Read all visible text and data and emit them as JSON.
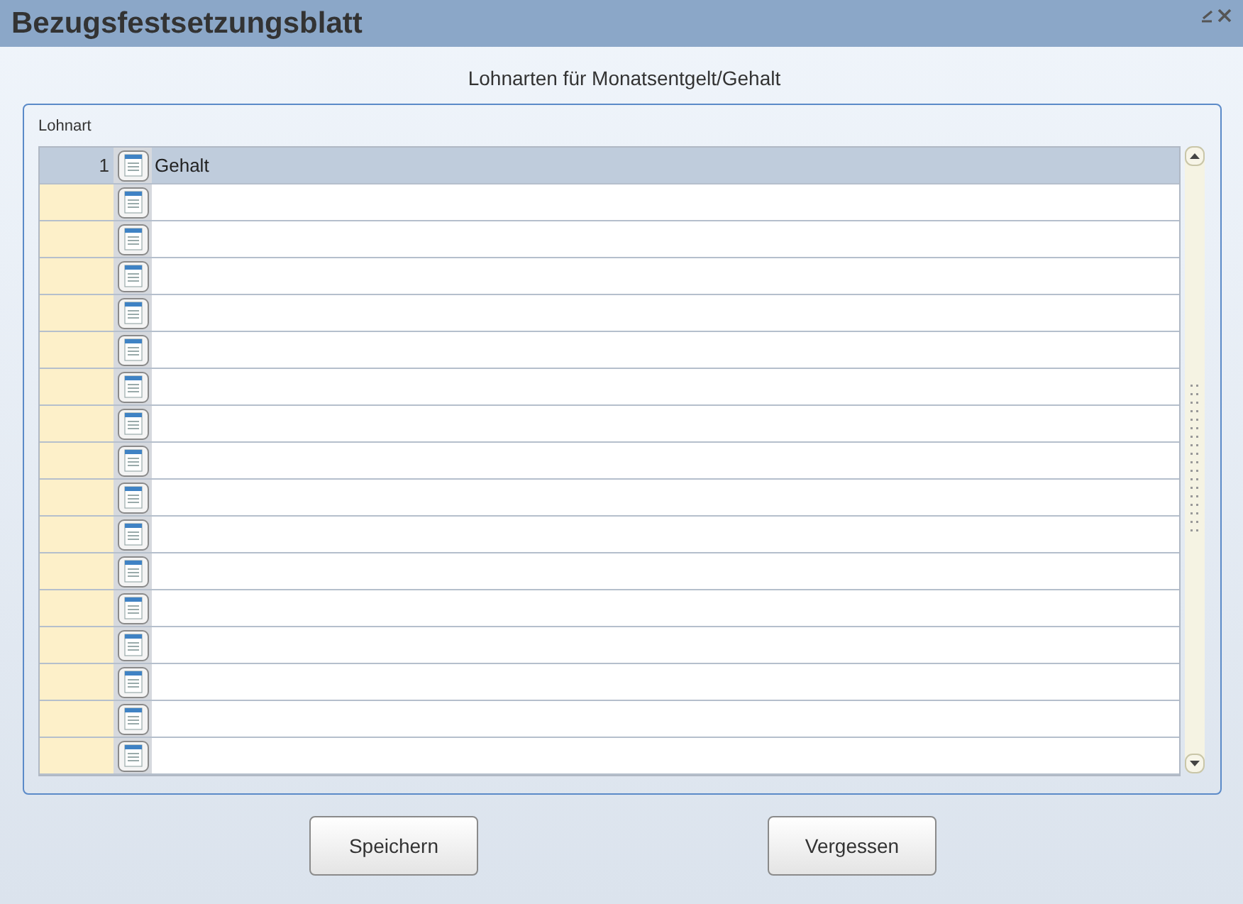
{
  "window": {
    "title": "Bezugsfestsetzungsblatt"
  },
  "heading": "Lohnarten für Monatsentgelt/Gehalt",
  "group": {
    "label": "Lohnart"
  },
  "rows": [
    {
      "number": "1",
      "name": "Gehalt",
      "selected": true
    },
    {
      "selected": false
    },
    {
      "selected": false
    },
    {
      "selected": false
    },
    {
      "selected": false
    },
    {
      "selected": false
    },
    {
      "selected": false
    },
    {
      "selected": false
    },
    {
      "selected": false
    },
    {
      "selected": false
    },
    {
      "selected": false
    },
    {
      "selected": false
    },
    {
      "selected": false
    },
    {
      "selected": false
    },
    {
      "selected": false
    },
    {
      "selected": false
    },
    {
      "selected": false
    }
  ],
  "buttons": [
    "Speichern",
    "Vergessen"
  ]
}
